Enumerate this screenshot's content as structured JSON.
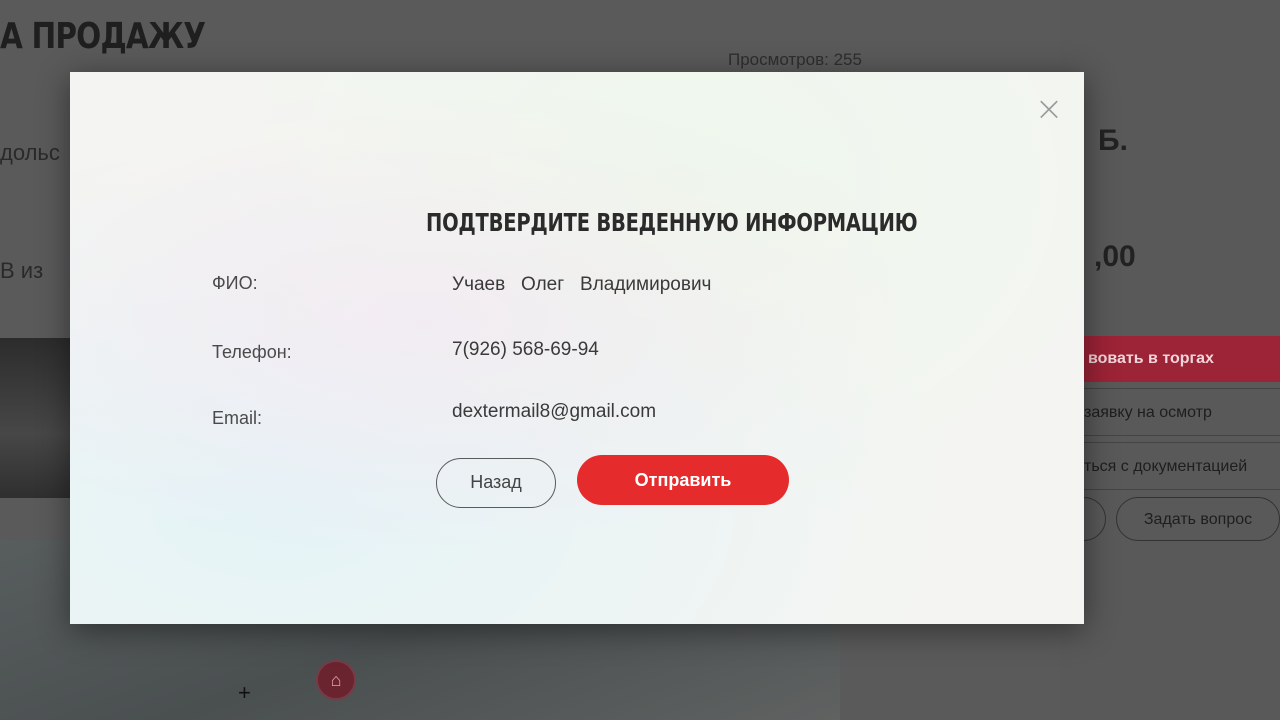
{
  "background": {
    "heading": "А ПРОДАЖУ",
    "views": "Просмотров: 255",
    "cut_text_1": "дольс",
    "cut_text_2": "В из",
    "price_fragment_1": "Б.",
    "price_fragment_2": ",00",
    "sidebar": {
      "participate": "вовать в торгах",
      "inspection": "заявку на осмотр",
      "documents": "ться с документацией",
      "ask_question": "Задать вопрос"
    }
  },
  "modal": {
    "title": "ПОДТВЕРДИТЕ ВВЕДЕННУЮ ИНФОРМАЦИЮ",
    "close_icon": "close-icon",
    "fields": [
      {
        "label": "ФИО:",
        "value": "Учаев   Олег   Владимирович"
      },
      {
        "label": "Телефон:",
        "value": "7(926) 568-69-94"
      },
      {
        "label": "Email:",
        "value": "dextermail8@gmail.com"
      }
    ],
    "back_label": "Назад",
    "submit_label": "Отправить"
  },
  "colors": {
    "accent": "#e52b2b",
    "background_red": "#9d2336",
    "modal_bg": "#f4f5f2"
  }
}
